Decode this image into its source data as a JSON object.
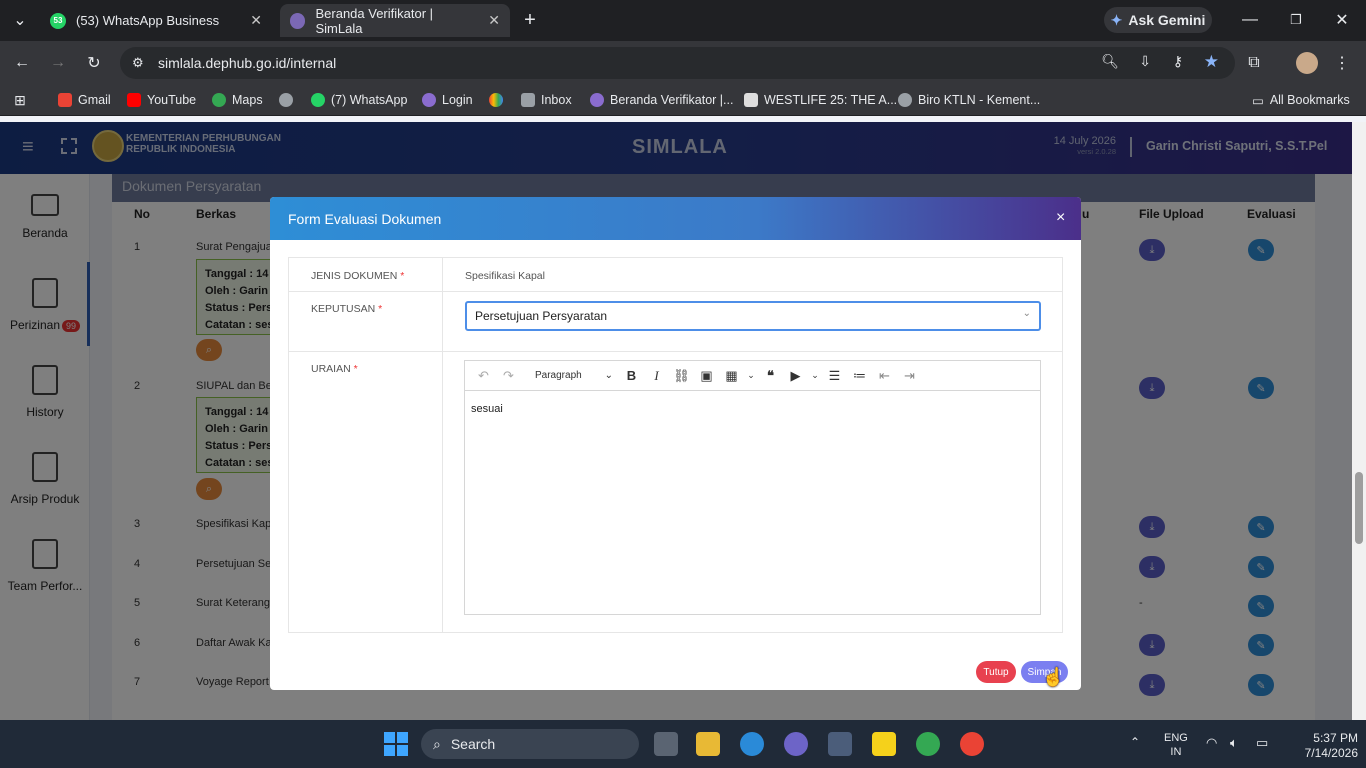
{
  "browser": {
    "tabs": [
      {
        "label": "(53) WhatsApp Business",
        "badge": "53"
      },
      {
        "label": "Beranda Verifikator | SimLala"
      }
    ],
    "new_tab": "+",
    "ask_gemini": "Ask Gemini",
    "url": "simlala.dephub.go.id/internal",
    "bookmarks": [
      "Gmail",
      "YouTube",
      "Maps",
      "(7) WhatsApp",
      "Login",
      "Inbox",
      "Beranda Verifikator |...",
      "WESTLIFE 25: THE A...",
      "Biro KTLN - Kement..."
    ],
    "all_bookmarks": "All Bookmarks"
  },
  "app": {
    "brand_line1": "KEMENTERIAN PERHUBUNGAN",
    "brand_line2": "REPUBLIK INDONESIA",
    "title": "SIMLALA",
    "date": "14 July 2026",
    "version": "versi 2.0.28",
    "user": "Garin Christi Saputri, S.S.T.Pel"
  },
  "sidebar": {
    "items": [
      {
        "label": "Beranda"
      },
      {
        "label": "Perizinan",
        "badge": "99"
      },
      {
        "label": "History"
      },
      {
        "label": "Arsip Produk"
      },
      {
        "label": "Team Perfor..."
      }
    ]
  },
  "table": {
    "card_title": "Dokumen Persyaratan",
    "headers": [
      "No",
      "Berkas",
      "u",
      "File Upload",
      "Evaluasi"
    ],
    "rows": [
      {
        "no": "1",
        "berkas": "Surat Pengajuan",
        "has_box": true
      },
      {
        "no": "2",
        "berkas": "SIUPAL dan Beri",
        "has_box": true
      },
      {
        "no": "3",
        "berkas": "Spesifikasi Kapa"
      },
      {
        "no": "4",
        "berkas": "Persetujuan Seb"
      },
      {
        "no": "5",
        "berkas": "Surat Keterangar",
        "upload": "-"
      },
      {
        "no": "6",
        "berkas": "Daftar Awak Kap"
      },
      {
        "no": "7",
        "berkas": "Voyage Report ("
      }
    ],
    "box_lines": [
      "Tanggal : 14",
      "Oleh : Garin",
      "Status : Pers",
      "Catatan : ses"
    ]
  },
  "modal": {
    "title": "Form Evaluasi Dokumen",
    "close": "×",
    "fields": {
      "jenis_label": "JENIS DOKUMEN",
      "jenis_value": "Spesifikasi Kapal",
      "keputusan_label": "KEPUTUSAN",
      "keputusan_value": "Persetujuan Persyaratan",
      "uraian_label": "URAIAN",
      "uraian_value": "sesuai",
      "required_mark": "*"
    },
    "toolbar": {
      "paragraph": "Paragraph"
    },
    "buttons": {
      "cancel": "Tutup",
      "save": "Simpan"
    },
    "colors": {
      "cancel": "#e8414f",
      "save": "#7b7ff0"
    }
  },
  "taskbar": {
    "search_placeholder": "Search",
    "lang1": "ENG",
    "lang2": "IN",
    "time": "5:37 PM",
    "date": "7/14/2026"
  }
}
